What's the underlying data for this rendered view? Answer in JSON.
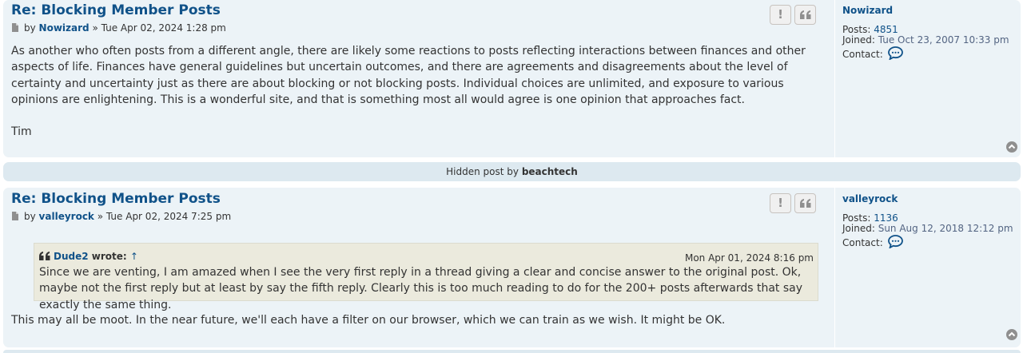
{
  "post1": {
    "title": "Re: Blocking Member Posts",
    "by": "by",
    "author": "Nowizard",
    "sep": "»",
    "date": "Tue Apr 02, 2024 1:28 pm",
    "body": [
      "As another who often posts from a different angle, there are likely some reactions to posts reflecting interactions between finances and other aspects of life. Finances have general guidelines but uncertain outcomes, and there are agreements and disagreements about the level of certainty and uncertainty just as there are about blocking or not blocking posts. Individual choices are unlimited, and exposure to various opinions are enlightening. This is a wonderful site, and that is something most all would agree is one opinion that approaches fact.",
      "Tim"
    ],
    "profile": {
      "username": "Nowizard",
      "posts_label": "Posts:",
      "posts_value": "4851",
      "joined_label": "Joined:",
      "joined_value": "Tue Oct 23, 2007 10:33 pm",
      "contact_label": "Contact:"
    },
    "report_icon": "exclamation-icon",
    "quote_icon": "quote-icon"
  },
  "hidden_post": {
    "prefix": "Hidden post by",
    "author": "beachtech"
  },
  "post2": {
    "title": "Re: Blocking Member Posts",
    "by": "by",
    "author": "valleyrock",
    "sep": "»",
    "date": "Tue Apr 02, 2024 7:25 pm",
    "quote": {
      "author": "Dude2",
      "wrote": "wrote:",
      "arrow": "↑",
      "date": "Mon Apr 01, 2024 8:16 pm",
      "body": "Since we are venting, I am amazed when I see the very first reply in a thread giving a clear and concise answer to the original post. Ok, maybe not the first reply but at least by say the fifth reply. Clearly this is too much reading to do for the 200+ posts afterwards that say exactly the same thing."
    },
    "body": "This may all be moot. In the near future, we'll each have a filter on our browser, which we can train as we wish. It might be OK.",
    "profile": {
      "username": "valleyrock",
      "posts_label": "Posts:",
      "posts_value": "1136",
      "joined_label": "Joined:",
      "joined_value": "Sun Aug 12, 2018 12:12 pm",
      "contact_label": "Contact:"
    }
  },
  "colors": {
    "post_bg": "#ecf3f7",
    "link": "#105289",
    "quote_bg": "#ebeadd"
  }
}
